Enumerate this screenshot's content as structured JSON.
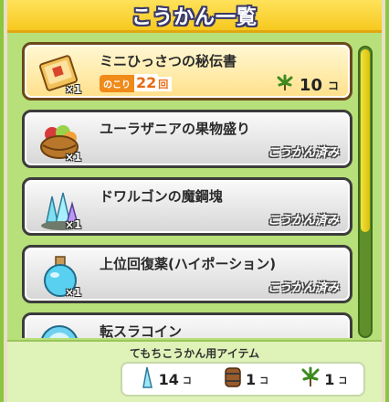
{
  "header": {
    "title": "こうかん一覧"
  },
  "items": [
    {
      "name": "ミニひっさつの秘伝書",
      "qty": "×1",
      "remaining_label": "のこり",
      "remaining": "22",
      "remaining_unit": "回",
      "cost": "10",
      "cost_unit": "コ",
      "icon": "scroll-book-icon",
      "status": ""
    },
    {
      "name": "ユーラザニアの果物盛り",
      "qty": "×1",
      "status": "こうかん済み",
      "icon": "fruit-basket-icon"
    },
    {
      "name": "ドワルゴンの魔鋼塊",
      "qty": "×1",
      "status": "こうかん済み",
      "icon": "crystal-ore-icon"
    },
    {
      "name": "上位回復薬(ハイポーション)",
      "qty": "×1",
      "status": "こうかん済み",
      "icon": "potion-flask-icon"
    },
    {
      "name": "転スラコイン",
      "qty": "",
      "status": "",
      "icon": "coin-icon"
    }
  ],
  "footer": {
    "title": "てもちこうかん用アイテム",
    "inventory": [
      {
        "icon": "crystal-shard-icon",
        "count": "14",
        "unit": "コ"
      },
      {
        "icon": "barrel-icon",
        "count": "1",
        "unit": "コ"
      },
      {
        "icon": "herb-plant-icon",
        "count": "1",
        "unit": "コ"
      }
    ]
  },
  "colors": {
    "accent": "#f7c91f",
    "panel": "#b7e07a",
    "remaining": "#f08a18"
  }
}
